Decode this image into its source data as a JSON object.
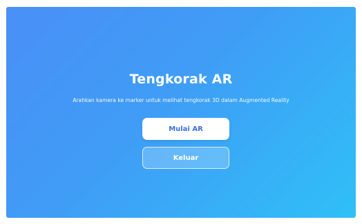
{
  "app": {
    "title": "Tengkorak AR",
    "subtitle": "Arahkan kamera ke marker untuk melihat tengkorak 3D dalam Augmented Reality"
  },
  "buttons": {
    "start_label": "Mulai AR",
    "exit_label": "Keluar"
  },
  "colors": {
    "gradient_start": "#4a8ff7",
    "gradient_end": "#2fc0f7",
    "primary_button_bg": "#ffffff",
    "primary_button_text": "#3a6fdc"
  }
}
